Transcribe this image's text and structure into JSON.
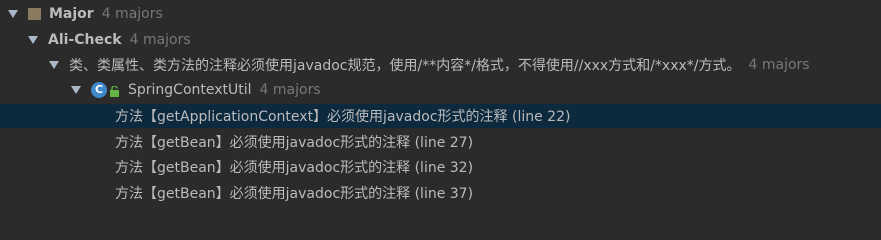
{
  "tree": {
    "root": {
      "label": "Major",
      "count": "4 majors"
    },
    "category": {
      "label": "Ali-Check",
      "count": "4 majors"
    },
    "rule": {
      "label": "类、类属性、类方法的注释必须使用javadoc规范，使用/**内容*/格式，不得使用//xxx方式和/*xxx*/方式。",
      "count": "4 majors"
    },
    "class_node": {
      "icon_letter": "C",
      "icon": "class-icon",
      "badge_icon": "lock-icon",
      "label": "SpringContextUtil",
      "count": "4 majors"
    },
    "issues": [
      {
        "text": "方法【getApplicationContext】必须使用javadoc形式的注释 (line 22)",
        "selected": true
      },
      {
        "text": "方法【getBean】必须使用javadoc形式的注释 (line 27)",
        "selected": false
      },
      {
        "text": "方法【getBean】必须使用javadoc形式的注释 (line 32)",
        "selected": false
      },
      {
        "text": "方法【getBean】必须使用javadoc形式的注释 (line 37)",
        "selected": false
      }
    ]
  },
  "colors": {
    "background": "#2b2b2b",
    "selection": "#0d293e",
    "text": "#bbbbbb",
    "muted": "#787878",
    "class_icon": "#3f8ac7",
    "lock_icon": "#62b543"
  }
}
